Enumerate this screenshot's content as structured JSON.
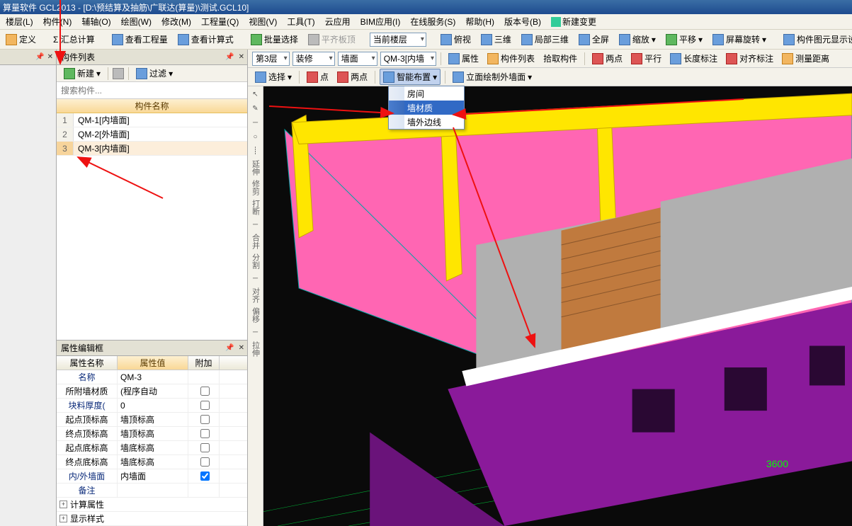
{
  "title_bar": "算量软件 GCL2013 - [D:\\预结算及抽筋\\广联达(算量)\\测试.GCL10]",
  "menu": {
    "items": [
      "楼层(L)",
      "构件(N)",
      "辅轴(O)",
      "绘图(W)",
      "修改(M)",
      "工程量(Q)",
      "视图(V)",
      "工具(T)",
      "云应用",
      "BIM应用(I)",
      "在线服务(S)",
      "帮助(H)",
      "版本号(B)"
    ],
    "newchange": "新建变更"
  },
  "toolbar1": {
    "define": "定义",
    "sumcalc": "Σ 汇总计算",
    "viewqty": "查看工程量",
    "viewexpr": "查看计算式",
    "batchsel": "批量选择",
    "flattop": "平齐板顶",
    "curfloor": "当前楼层",
    "topview": "俯视",
    "threed": "三维",
    "local3d": "局部三维",
    "fullscreen": "全屏",
    "zoom": "缩放",
    "pan": "平移",
    "screenrot": "屏幕旋转",
    "elemview": "构件图元显示设置"
  },
  "panel_left": {
    "title": "构件列表",
    "new_btn": "新建",
    "filter_btn": "过滤",
    "search_placeholder": "搜索构件...",
    "header": "构件名称",
    "rows": [
      {
        "idx": "1",
        "name": "QM-1[内墙面]"
      },
      {
        "idx": "2",
        "name": "QM-2[外墙面]"
      },
      {
        "idx": "3",
        "name": "QM-3[内墙面]"
      }
    ]
  },
  "prop_panel": {
    "title": "属性编辑框",
    "headers": [
      "属性名称",
      "属性值",
      "附加"
    ],
    "rows": [
      {
        "name": "名称",
        "val": "QM-3",
        "blue": true,
        "chk": false,
        "nochk": true
      },
      {
        "name": "所附墙材质",
        "val": "(程序自动",
        "blue": false,
        "chk": false
      },
      {
        "name": "块料厚度(",
        "val": "0",
        "blue": true,
        "chk": false
      },
      {
        "name": "起点顶标高",
        "val": "墙顶标高",
        "blue": false,
        "chk": false
      },
      {
        "name": "终点顶标高",
        "val": "墙顶标高",
        "blue": false,
        "chk": false
      },
      {
        "name": "起点底标高",
        "val": "墙底标高",
        "blue": false,
        "chk": false
      },
      {
        "name": "终点底标高",
        "val": "墙底标高",
        "blue": false,
        "chk": false
      },
      {
        "name": "内/外墙面",
        "val": "内墙面",
        "blue": true,
        "chk": true
      },
      {
        "name": "备注",
        "val": "",
        "blue": true,
        "chk": false,
        "nochk": true
      }
    ],
    "tree": [
      "计算属性",
      "显示样式"
    ]
  },
  "viewbar": {
    "floor_sel": "第3层",
    "cat_sel": "装修",
    "type_sel": "墙面",
    "comp_sel": "QM-3[内墙",
    "props": "属性",
    "complist": "构件列表",
    "pickcomp": "拾取构件",
    "twopts": "两点",
    "parallel": "平行",
    "lendim": "长度标注",
    "aligndim": "对齐标注",
    "measdist": "测量距离"
  },
  "viewbar2": {
    "select": "选择",
    "point": "点",
    "twopt": "两点",
    "smart": "智能布置",
    "faceedit": "立面绘制外墙面",
    "dropdown": [
      "房间",
      "墙材质",
      "墙外边线"
    ]
  },
  "leftsidebar": {
    "labels": [
      "延伸",
      "修剪",
      "打断",
      "合并",
      "分割",
      "对齐",
      "偏移",
      "拉伸"
    ]
  },
  "dimension": "3600"
}
